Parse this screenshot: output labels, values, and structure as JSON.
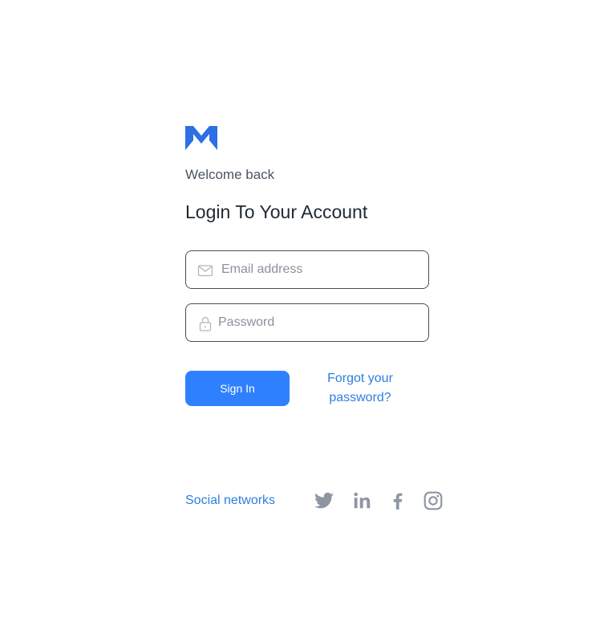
{
  "brand": {
    "logo_icon": "brand-logo-m-icon",
    "accent_color": "#2f6fe4"
  },
  "header": {
    "welcome": "Welcome back",
    "title": "Login To Your Account"
  },
  "form": {
    "email": {
      "icon": "mail-icon",
      "placeholder": "Email address",
      "value": ""
    },
    "password": {
      "icon": "lock-icon",
      "placeholder": "Password",
      "value": ""
    },
    "signin_label": "Sign In",
    "forgot_label_line1": "Forgot your",
    "forgot_label_line2": "password?",
    "button_color": "#2f80ff",
    "link_color": "#2f7de1"
  },
  "social": {
    "label": "Social networks",
    "icons": [
      "twitter-icon",
      "linkedin-icon",
      "facebook-icon",
      "instagram-icon"
    ],
    "icon_color": "#8f96a3"
  }
}
